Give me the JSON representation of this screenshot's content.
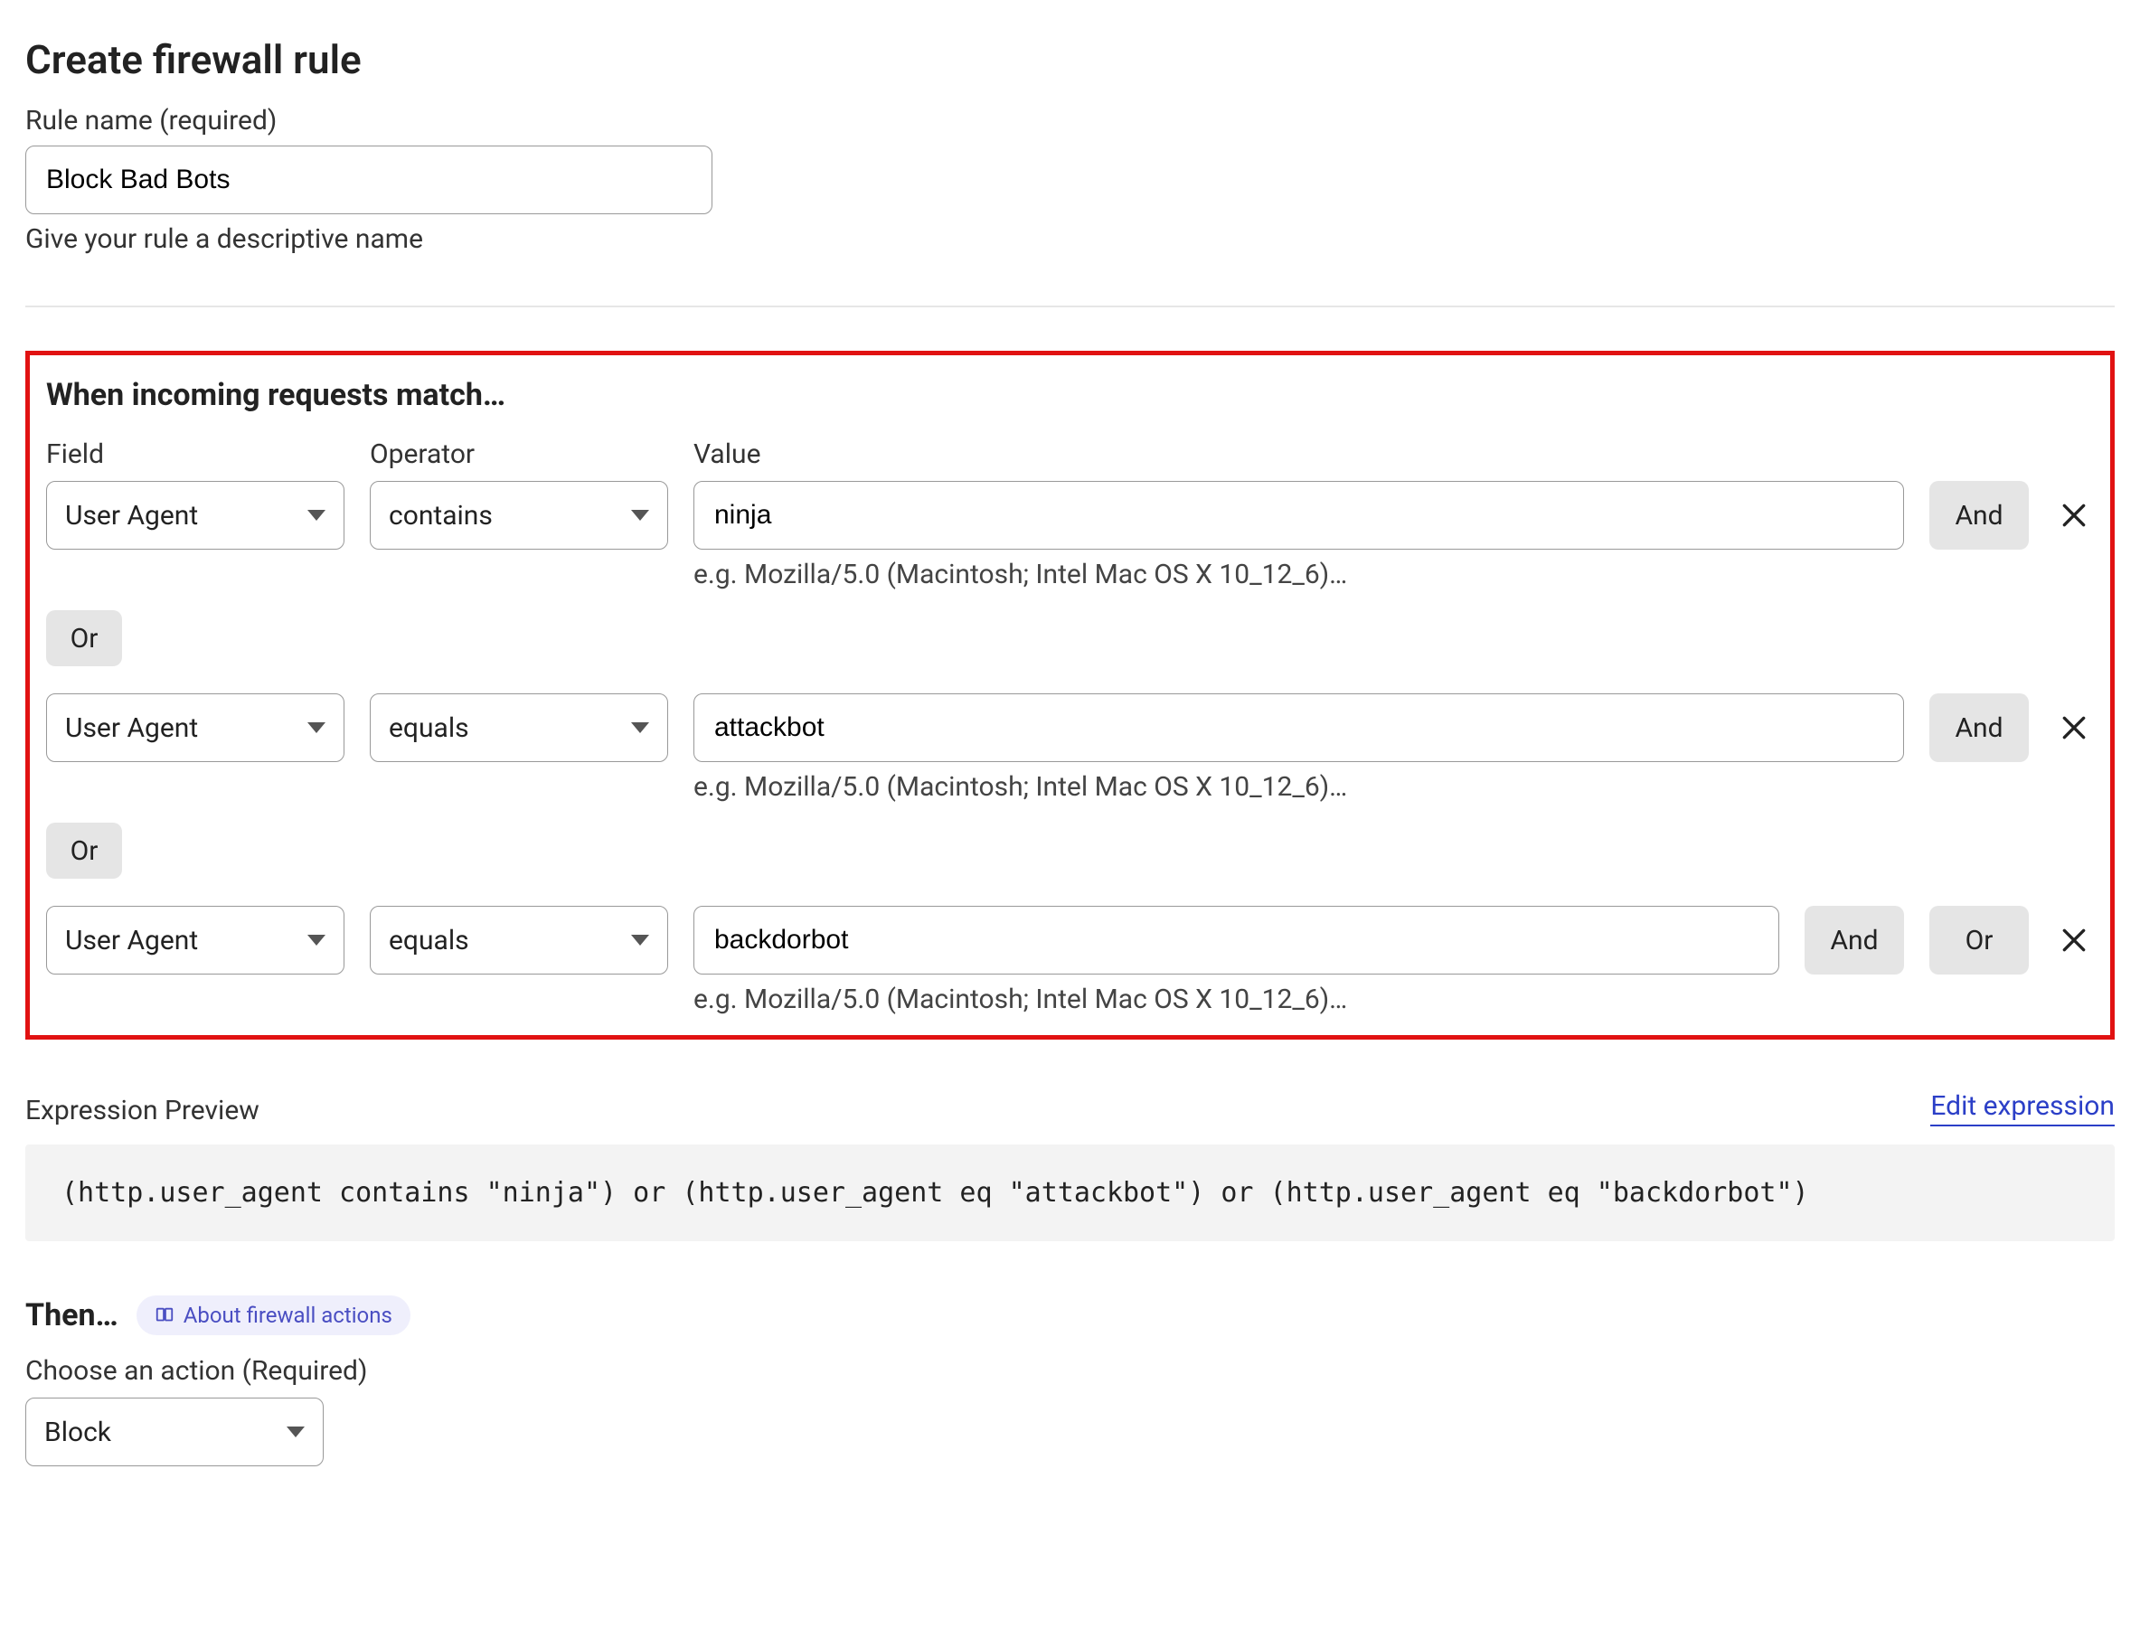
{
  "page_title": "Create firewall rule",
  "rule_name": {
    "label": "Rule name (required)",
    "value": "Block Bad Bots",
    "helper": "Give your rule a descriptive name"
  },
  "match": {
    "title": "When incoming requests match…",
    "headers": {
      "field": "Field",
      "operator": "Operator",
      "value": "Value"
    },
    "example_hint": "e.g. Mozilla/5.0 (Macintosh; Intel Mac OS X 10_12_6)…",
    "and_label": "And",
    "or_label": "Or",
    "rows": [
      {
        "field": "User Agent",
        "operator": "contains",
        "value": "ninja",
        "trailing": [
          "And"
        ]
      },
      {
        "field": "User Agent",
        "operator": "equals",
        "value": "attackbot",
        "trailing": [
          "And"
        ]
      },
      {
        "field": "User Agent",
        "operator": "equals",
        "value": "backdorbot",
        "trailing": [
          "And",
          "Or"
        ]
      }
    ]
  },
  "expression_preview": {
    "label": "Expression Preview",
    "edit_link": "Edit expression",
    "expression": "(http.user_agent contains \"ninja\") or (http.user_agent eq \"attackbot\") or (http.user_agent eq \"backdorbot\")"
  },
  "then": {
    "title": "Then…",
    "about_link": "About firewall actions",
    "action_label": "Choose an action (Required)",
    "action_value": "Block"
  }
}
